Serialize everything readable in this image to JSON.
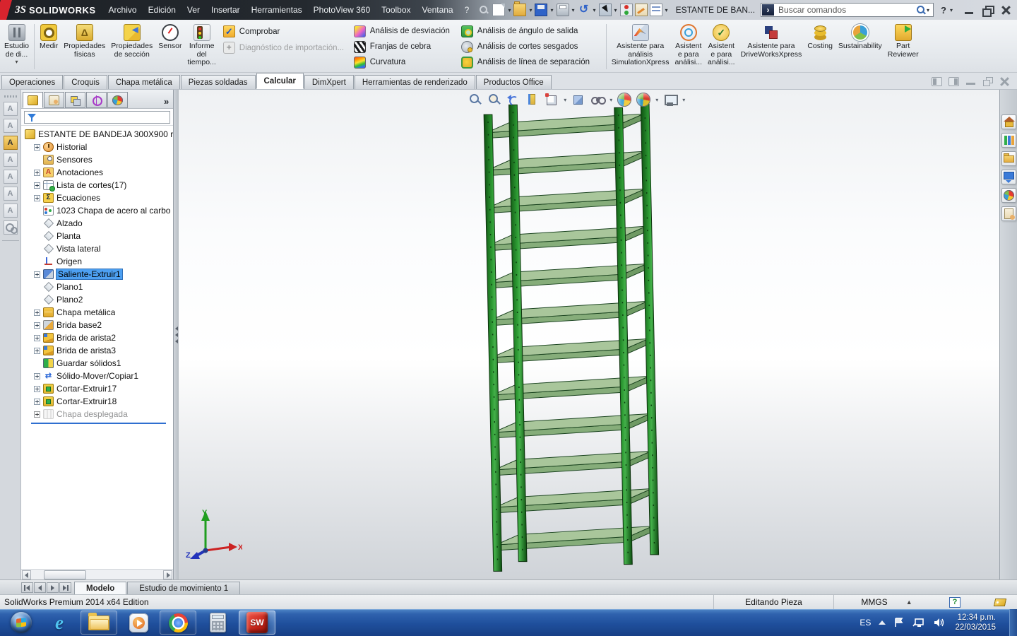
{
  "titlebar": {
    "logo_text": "SOLIDWORKS",
    "menus": [
      "Archivo",
      "Edición",
      "Ver",
      "Insertar",
      "Herramientas",
      "PhotoView 360",
      "Toolbox",
      "Ventana",
      "?"
    ],
    "quick_access_icons": [
      "new-document-icon",
      "open-icon",
      "save-icon",
      "print-icon",
      "undo-icon",
      "select-cursor-icon",
      "interference-lights-icon",
      "file-properties-icon",
      "options-icon"
    ],
    "document_title": "ESTANTE DE BAN...",
    "search": {
      "placeholder": "Buscar comandos",
      "icon": "search-icon"
    },
    "help_label": "?"
  },
  "ribbon": {
    "study_button": {
      "label": "Estudio\nde di...",
      "icon": "design-study-icon"
    },
    "tool_buttons": [
      {
        "label": "Medir",
        "icon": "measure-icon",
        "ic": "ic-measure"
      },
      {
        "label": "Propiedades\nfísicas",
        "icon": "mass-properties-icon",
        "ic": "ic-mass"
      },
      {
        "label": "Propiedades\nde sección",
        "icon": "section-properties-icon",
        "ic": "ic-section"
      },
      {
        "label": "Sensor",
        "icon": "sensor-icon",
        "ic": "ic-sensor"
      },
      {
        "label": "Informe\ndel\ntiempo...",
        "icon": "performance-report-icon",
        "ic": "ic-report"
      }
    ],
    "check_buttons": [
      {
        "label": "Comprobar",
        "icon": "check-entity-icon",
        "ic": "ic-check"
      },
      {
        "label": "Diagnóstico de importación...",
        "icon": "import-diagnostics-icon",
        "ic": "ic-importdiag",
        "cls": "dis"
      }
    ],
    "analysis_buttons_a": [
      {
        "label": "Análisis de desviación",
        "icon": "deviation-analysis-icon",
        "ic": "ic-deviation"
      },
      {
        "label": "Franjas de cebra",
        "icon": "zebra-stripes-icon",
        "ic": "ic-zebra"
      },
      {
        "label": "Curvatura",
        "icon": "curvature-icon",
        "ic": "ic-curvature"
      }
    ],
    "analysis_buttons_b": [
      {
        "label": "Análisis de ángulo de salida",
        "icon": "draft-analysis-icon",
        "ic": "ic-draft"
      },
      {
        "label": "Análisis de cortes sesgados",
        "icon": "undercut-analysis-icon",
        "ic": "ic-undercut"
      },
      {
        "label": "Análisis de línea de separación",
        "icon": "parting-line-analysis-icon",
        "ic": "ic-parting"
      }
    ],
    "wizard_buttons": [
      {
        "label": "Asistente para\nanálisis\nSimulationXpress",
        "icon": "simulationxpress-wizard-icon",
        "ic": "ic-simx"
      },
      {
        "label": "Asistent\ne para\nanálisi...",
        "icon": "floxpress-wizard-icon",
        "ic": "ic-flox"
      },
      {
        "label": "Asistent\ne para\nanálisi...",
        "icon": "dfmxpress-wizard-icon",
        "ic": "ic-dfm"
      },
      {
        "label": "Asistente para\nDriveWorksXpress",
        "icon": "driveworksxpress-wizard-icon",
        "ic": "ic-driveworks"
      },
      {
        "label": "Costing",
        "icon": "costing-icon",
        "ic": "ic-costing"
      },
      {
        "label": "Sustainability",
        "icon": "sustainability-icon",
        "ic": "ic-sustain"
      },
      {
        "label": "Part\nReviewer",
        "icon": "part-reviewer-icon",
        "ic": "ic-partrev"
      }
    ]
  },
  "command_tabs": [
    {
      "label": "Operaciones"
    },
    {
      "label": "Croquis"
    },
    {
      "label": "Chapa metálica"
    },
    {
      "label": "Piezas soldadas"
    },
    {
      "label": "Calcular",
      "cls": "active"
    },
    {
      "label": "DimXpert"
    },
    {
      "label": "Herramientas de renderizado"
    },
    {
      "label": "Productos Office"
    }
  ],
  "feature_tree": {
    "panel_tab_icons": [
      "featuremanager-tab-icon",
      "propertymanager-tab-icon",
      "configurationmanager-tab-icon",
      "dimxpertmanager-tab-icon",
      "displaymanager-tab-icon"
    ],
    "expand_label": "»",
    "filter_icon": "filter-icon",
    "root": "ESTANTE DE BANDEJA 300X900 r",
    "items": [
      {
        "label": "Historial",
        "icon": "history-icon",
        "ic": "i-history",
        "cls": "has-exp"
      },
      {
        "label": "Sensores",
        "icon": "sensors-icon",
        "ic": "i-sensors"
      },
      {
        "label": "Anotaciones",
        "icon": "annotations-icon",
        "ic": "i-annot",
        "cls": "has-exp"
      },
      {
        "label": "Lista de cortes(17)",
        "icon": "cut-list-icon",
        "ic": "i-cutlist",
        "cls": "has-exp"
      },
      {
        "label": "Ecuaciones",
        "icon": "equations-icon",
        "ic": "i-eq",
        "cls": "has-exp"
      },
      {
        "label": "1023 Chapa de acero al carbo",
        "icon": "material-icon",
        "ic": "i-mat"
      },
      {
        "label": "Alzado",
        "icon": "plane-icon",
        "ic": "i-plane"
      },
      {
        "label": "Planta",
        "icon": "plane-icon",
        "ic": "i-plane"
      },
      {
        "label": "Vista lateral",
        "icon": "plane-icon",
        "ic": "i-plane"
      },
      {
        "label": "Origen",
        "icon": "origin-icon",
        "ic": "i-origin"
      },
      {
        "label": "Saliente-Extruir1",
        "icon": "boss-extrude-icon",
        "ic": "i-extrude",
        "cls": "has-exp sel"
      },
      {
        "label": "Plano1",
        "icon": "plane-icon",
        "ic": "i-plane"
      },
      {
        "label": "Plano2",
        "icon": "plane-icon",
        "ic": "i-plane"
      },
      {
        "label": "Chapa metálica",
        "icon": "sheet-metal-icon",
        "ic": "i-sheet",
        "cls": "has-exp"
      },
      {
        "label": "Brida base2",
        "icon": "base-flange-icon",
        "ic": "i-flange1",
        "cls": "has-exp"
      },
      {
        "label": "Brida de arista2",
        "icon": "edge-flange-icon",
        "ic": "i-flange2",
        "cls": "has-exp"
      },
      {
        "label": "Brida de arista3",
        "icon": "edge-flange-icon",
        "ic": "i-flange2",
        "cls": "has-exp"
      },
      {
        "label": "Guardar sólidos1",
        "icon": "save-bodies-icon",
        "ic": "i-savebodies"
      },
      {
        "label": "Sólido-Mover/Copiar1",
        "icon": "move-copy-body-icon",
        "ic": "i-movecopy",
        "cls": "has-exp"
      },
      {
        "label": "Cortar-Extruir17",
        "icon": "cut-extrude-icon",
        "ic": "i-cut",
        "cls": "has-exp"
      },
      {
        "label": "Cortar-Extruir18",
        "icon": "cut-extrude-icon",
        "ic": "i-cut",
        "cls": "has-exp"
      },
      {
        "label": "Chapa desplegada",
        "icon": "flat-pattern-icon",
        "ic": "i-flat",
        "cls": "has-exp dis"
      }
    ]
  },
  "viewport": {
    "hud_icons": [
      "zoom-fit-icon",
      "zoom-area-icon",
      "previous-view-icon",
      "section-view-icon",
      "view-orientation-icon",
      "display-style-icon",
      "hide-show-items-icon",
      "edit-appearance-icon",
      "apply-scene-icon",
      "view-settings-icon"
    ],
    "triad": {
      "x": "X",
      "y": "Y",
      "z": "Z"
    },
    "window_controls": [
      "pane-left-icon",
      "pane-right-icon",
      "minimize-icon",
      "restore-icon",
      "close-icon"
    ]
  },
  "task_pane_icons": [
    "resources-home-icon",
    "design-library-icon",
    "file-explorer-icon",
    "view-palette-icon",
    "appearances-icon",
    "custom-properties-icon"
  ],
  "left_toolbar_icons": [
    "annotation-star-icon",
    "annotation-hand-icon",
    "open-annotation-folder-icon",
    "annotation-add-icon",
    "annotation-group-icon",
    "annotation-save-icon",
    "annotation-frame-icon",
    "gear-tools-icon"
  ],
  "model_tabs": {
    "nav_icons": [
      "first-tab-icon",
      "previous-tab-icon",
      "next-tab-icon",
      "last-tab-icon"
    ],
    "tabs": [
      {
        "label": "Modelo",
        "cls": "active"
      },
      {
        "label": "Estudio de movimiento 1"
      }
    ]
  },
  "statusbar": {
    "left": "SolidWorks Premium 2014 x64 Edition",
    "editing": "Editando Pieza",
    "units": "MMGS",
    "help_glyph": "?"
  },
  "taskbar": {
    "app_icons": [
      "start-button",
      "internet-explorer-icon",
      "windows-explorer-icon",
      "media-player-icon",
      "chrome-icon",
      "calculator-icon",
      "solidworks-icon"
    ],
    "tray": {
      "language": "ES",
      "tray_icons": [
        "show-hidden-icons-icon",
        "action-center-flag-icon",
        "network-icon",
        "volume-icon"
      ],
      "time": "12:34 p.m.",
      "date": "22/03/2015"
    }
  }
}
